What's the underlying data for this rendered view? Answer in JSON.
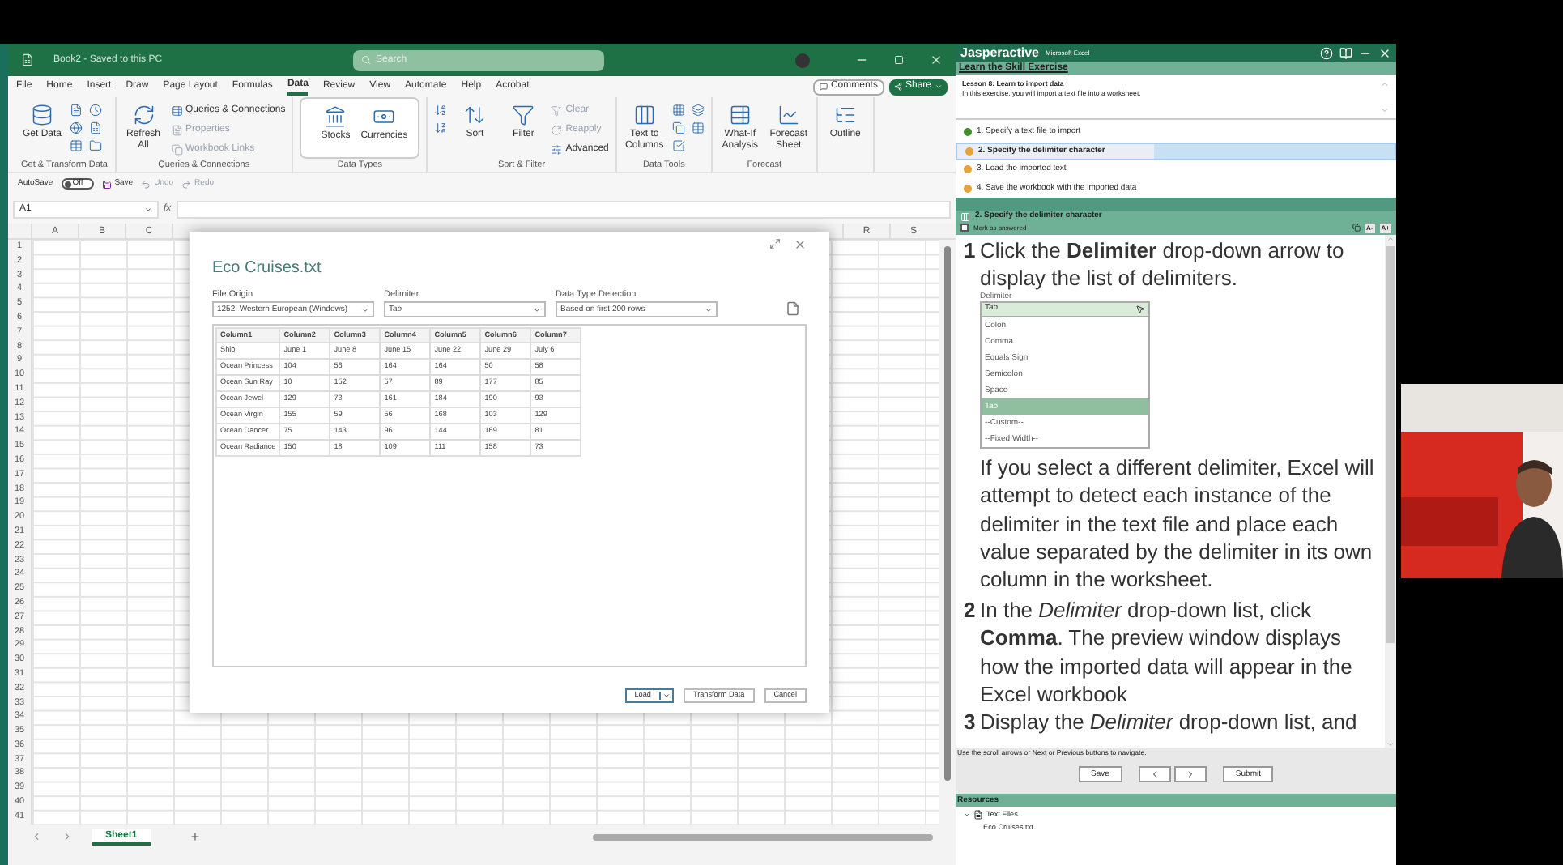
{
  "excel": {
    "title": "Book2 - Saved to this PC",
    "search": {
      "placeholder": "Search"
    },
    "ribbon_tabs": [
      {
        "label": "File",
        "selected": false
      },
      {
        "label": "Home",
        "selected": false
      },
      {
        "label": "Insert",
        "selected": false
      },
      {
        "label": "Draw",
        "selected": false
      },
      {
        "label": "Page Layout",
        "selected": false
      },
      {
        "label": "Formulas",
        "selected": false
      },
      {
        "label": "Data",
        "selected": true
      },
      {
        "label": "Review",
        "selected": false
      },
      {
        "label": "View",
        "selected": false
      },
      {
        "label": "Automate",
        "selected": false
      },
      {
        "label": "Help",
        "selected": false
      },
      {
        "label": "Acrobat",
        "selected": false
      }
    ],
    "comments_button": "Comments",
    "share_button": "Share",
    "ribbon_groups": [
      {
        "label": "Get & Transform Data",
        "items": [
          {
            "kind": "large",
            "label": "Get Data",
            "disabled": false
          },
          {
            "kind": "icon",
            "disabled": false
          },
          {
            "kind": "icon",
            "disabled": false
          },
          {
            "kind": "icon",
            "disabled": false
          },
          {
            "kind": "icon",
            "disabled": false
          },
          {
            "kind": "icon",
            "disabled": false
          },
          {
            "kind": "icon",
            "disabled": false
          }
        ]
      },
      {
        "label": "Queries & Connections",
        "items": [
          {
            "kind": "large",
            "label": "Refresh All",
            "disabled": false
          },
          {
            "kind": "small",
            "label": "Queries & Connections",
            "disabled": false
          },
          {
            "kind": "small",
            "label": "Properties",
            "disabled": true
          },
          {
            "kind": "small",
            "label": "Workbook Links",
            "disabled": true
          }
        ]
      },
      {
        "label": "Data Types",
        "items": [
          {
            "kind": "large",
            "label": "Stocks",
            "disabled": false
          },
          {
            "kind": "large",
            "label": "Currencies",
            "disabled": false
          }
        ]
      },
      {
        "label": "Sort & Filter",
        "items": [
          {
            "kind": "icon",
            "disabled": false
          },
          {
            "kind": "icon",
            "disabled": false
          },
          {
            "kind": "large",
            "label": "Sort",
            "disabled": false
          },
          {
            "kind": "large",
            "label": "Filter",
            "disabled": false
          },
          {
            "kind": "small",
            "label": "Clear",
            "disabled": true
          },
          {
            "kind": "small",
            "label": "Reapply",
            "disabled": true
          },
          {
            "kind": "small",
            "label": "Advanced",
            "disabled": false
          }
        ]
      },
      {
        "label": "Data Tools",
        "items": [
          {
            "kind": "large",
            "label": "Text to Columns",
            "disabled": false
          },
          {
            "kind": "icon",
            "disabled": false
          },
          {
            "kind": "icon",
            "disabled": false
          },
          {
            "kind": "icon",
            "disabled": false
          },
          {
            "kind": "icon",
            "disabled": false
          },
          {
            "kind": "icon",
            "disabled": false
          }
        ]
      },
      {
        "label": "Forecast",
        "items": [
          {
            "kind": "large",
            "label": "What-If Analysis",
            "disabled": false
          },
          {
            "kind": "large",
            "label": "Forecast Sheet",
            "disabled": false
          }
        ]
      },
      {
        "items": [
          {
            "kind": "large",
            "label": "Outline",
            "disabled": false
          }
        ]
      }
    ],
    "quick_access": {
      "autosave_label": "AutoSave",
      "autosave": {
        "label": "Off",
        "on": false
      },
      "save": "Save",
      "undo": {
        "label": "Undo",
        "disabled": true
      },
      "redo": {
        "label": "Redo",
        "disabled": true
      }
    },
    "name_box": "A1",
    "formula_label": "fx",
    "column_headers": [
      "A",
      "B",
      "C",
      "R",
      "S"
    ],
    "row_numbers": [
      "1",
      "2",
      "3",
      "4",
      "5",
      "6",
      "7",
      "8",
      "9",
      "10",
      "11",
      "12",
      "13",
      "14",
      "15",
      "16",
      "17",
      "18",
      "19",
      "20",
      "21",
      "22",
      "23",
      "24",
      "25",
      "26",
      "27",
      "28",
      "29",
      "30",
      "31",
      "32",
      "33",
      "34",
      "35",
      "36",
      "37",
      "38",
      "39",
      "40",
      "41"
    ],
    "sheet_tabs": [
      {
        "label": "Sheet1",
        "selected": true
      }
    ],
    "dialog": {
      "title": "Eco Cruises.txt",
      "fields": [
        {
          "label": "File Origin",
          "value": "1252: Western European (Windows)"
        },
        {
          "label": "Delimiter",
          "value": "Tab"
        },
        {
          "label": "Data Type Detection",
          "value": "Based on first 200 rows"
        }
      ],
      "preview": {
        "columns": [
          "Column1",
          "Column2",
          "Column3",
          "Column4",
          "Column5",
          "Column6",
          "Column7"
        ],
        "rows": [
          [
            "Ship",
            "June 1",
            "June 8",
            "June 15",
            "June 22",
            "June 29",
            "July 6"
          ],
          [
            "Ocean Princess",
            "104",
            "56",
            "164",
            "164",
            "50",
            "58"
          ],
          [
            "Ocean Sun Ray",
            "10",
            "152",
            "57",
            "89",
            "177",
            "85"
          ],
          [
            "Ocean Jewel",
            "129",
            "73",
            "161",
            "184",
            "190",
            "93"
          ],
          [
            "Ocean Virgin",
            "155",
            "59",
            "56",
            "168",
            "103",
            "129"
          ],
          [
            "Ocean Dancer",
            "75",
            "143",
            "96",
            "144",
            "169",
            "81"
          ],
          [
            "Ocean Radiance",
            "150",
            "18",
            "109",
            "111",
            "158",
            "73"
          ]
        ]
      },
      "buttons": [
        {
          "label": "Load",
          "kind": "split"
        },
        {
          "label": "Transform Data",
          "kind": "plain"
        },
        {
          "label": "Cancel",
          "kind": "plain"
        }
      ]
    }
  },
  "tutor": {
    "brand": "Jasperactive",
    "product": "Microsoft Excel",
    "section_title": "Learn the Skill Exercise",
    "lesson_title": "Lesson 8: Learn to import data",
    "lesson_description": "In this exercise, you will import a text file into a worksheet.",
    "steps": [
      {
        "label": "1. Specify a text file to import",
        "done": true,
        "selected": false
      },
      {
        "label": "2. Specify the delimiter character",
        "done": false,
        "selected": true
      },
      {
        "label": "3. Load the imported text",
        "done": false,
        "selected": false
      },
      {
        "label": "4. Save the workbook with the imported data",
        "done": false,
        "selected": false
      }
    ],
    "step_header": "2. Specify the delimiter character",
    "mark_answered": {
      "label": "Mark as answered",
      "checked": false
    },
    "font_buttons": [
      "A-",
      "A+"
    ],
    "content": [
      {
        "kind": "step",
        "number": "1",
        "text": "Click the **Delimiter** drop-down arrow to display the list of delimiters."
      },
      {
        "kind": "figure",
        "label": "Delimiter",
        "value": "Tab",
        "options": [
          {
            "label": "Colon",
            "selected": false
          },
          {
            "label": "Comma",
            "selected": false
          },
          {
            "label": "Equals Sign",
            "selected": false
          },
          {
            "label": "Semicolon",
            "selected": false
          },
          {
            "label": "Space",
            "selected": false
          },
          {
            "label": "Tab",
            "selected": true
          },
          {
            "label": "--Custom--",
            "selected": false
          },
          {
            "label": "--Fixed Width--",
            "selected": false
          }
        ]
      },
      {
        "kind": "note",
        "text": "If you select a different delimiter, Excel will attempt to detect each instance of the delimiter in the text file and place each value separated by the delimiter in its own column in the worksheet."
      },
      {
        "kind": "step",
        "number": "2",
        "text": "In the *Delimiter* drop-down list, click **Comma**. The preview window displays how the imported data will appear in the Excel workbook"
      },
      {
        "kind": "step",
        "number": "3",
        "text": "Display the *Delimiter* drop-down list, and"
      }
    ],
    "nav_hint": "Use the scroll arrows or Next or Previous buttons to navigate.",
    "nav_buttons": [
      {
        "kind": "text",
        "label": "Save"
      },
      {
        "kind": "previous"
      },
      {
        "kind": "next"
      },
      {
        "kind": "text",
        "label": "Submit"
      }
    ],
    "resources_title": "Resources",
    "resources": [
      {
        "label": "Text Files",
        "expanded": true,
        "children": [
          {
            "label": "Eco Cruises.txt"
          }
        ]
      }
    ]
  }
}
